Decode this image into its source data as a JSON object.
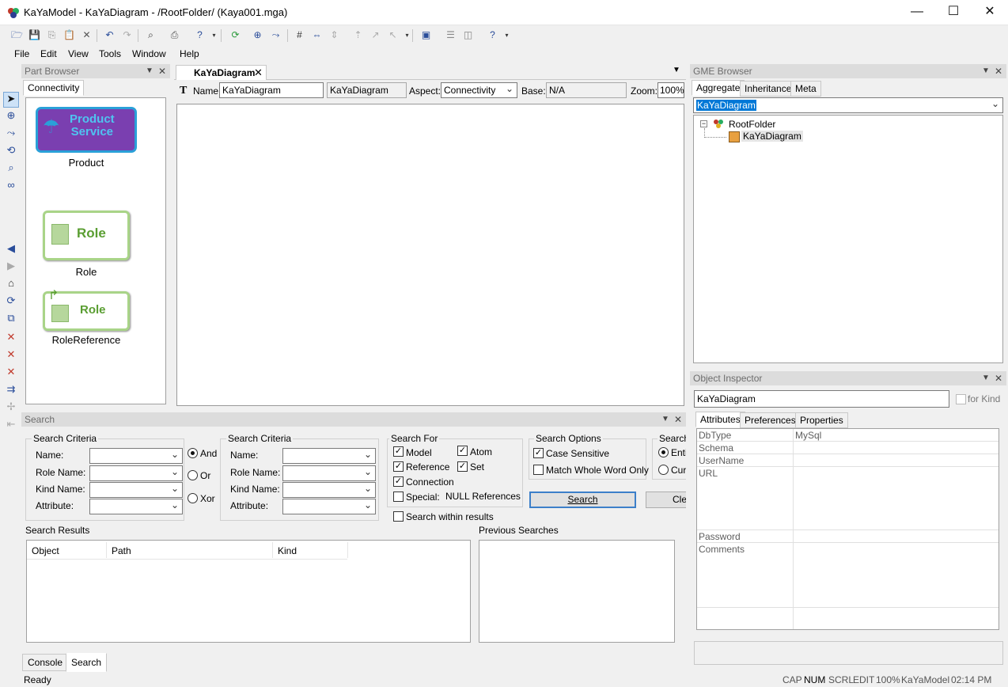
{
  "window": {
    "title": "KaYaModel - KaYaDiagram - /RootFolder/ (Kaya001.mga)",
    "minimize": "—",
    "maximize": "☐",
    "close": "✕"
  },
  "menu": [
    "File",
    "Edit",
    "View",
    "Tools",
    "Window",
    "Help"
  ],
  "part_browser": {
    "title": "Part Browser",
    "tab": "Connectivity",
    "parts": [
      {
        "label": "Product",
        "icon_text_1": "Product",
        "icon_text_2": "Service"
      },
      {
        "label": "Role",
        "icon_text": "Role"
      },
      {
        "label": "RoleReference",
        "icon_text": "Role"
      }
    ]
  },
  "editor": {
    "tab": "KaYaDiagram",
    "name_label": "Name:",
    "name_value": "KaYaDiagram",
    "kind_value": "KaYaDiagram",
    "aspect_label": "Aspect:",
    "aspect_value": "Connectivity",
    "base_label": "Base:",
    "base_value": "N/A",
    "zoom_label": "Zoom:",
    "zoom_value": "100%"
  },
  "gme_browser": {
    "title": "GME Browser",
    "tabs": [
      "Aggregate",
      "Inheritance",
      "Meta"
    ],
    "selected": "KaYaDiagram",
    "tree": {
      "root": "RootFolder",
      "child": "KaYaDiagram"
    }
  },
  "object_inspector": {
    "title": "Object Inspector",
    "name": "KaYaDiagram",
    "for_kind": "for Kind",
    "tabs": [
      "Attributes",
      "Preferences",
      "Properties"
    ],
    "rows": [
      {
        "key": "DbType",
        "value": "MySql"
      },
      {
        "key": "Schema",
        "value": ""
      },
      {
        "key": "UserName",
        "value": ""
      },
      {
        "key": "URL",
        "value": ""
      },
      {
        "key": "Password",
        "value": ""
      },
      {
        "key": "Comments",
        "value": ""
      }
    ]
  },
  "search": {
    "title": "Search",
    "criteria_title": "Search Criteria",
    "criteria_labels": [
      "Name:",
      "Role Name:",
      "Kind Name:",
      "Attribute:"
    ],
    "logic": [
      "And",
      "Or",
      "Xor"
    ],
    "search_for_title": "Search For",
    "search_for": {
      "model": "Model",
      "atom": "Atom",
      "reference": "Reference",
      "set": "Set",
      "connection": "Connection",
      "special": "Special:",
      "null_refs": "NULL References"
    },
    "options_title": "Search Options",
    "case_sensitive": "Case Sensitive",
    "match_whole": "Match Whole Word Only",
    "scope_title": "Search",
    "scope": [
      "Entire",
      "Current"
    ],
    "search_button": "Search",
    "clear_button": "Clear",
    "within_results": "Search within results",
    "results_label": "Search Results",
    "results_cols": [
      "Object",
      "Path",
      "Kind"
    ],
    "previous_label": "Previous Searches"
  },
  "bottom_tabs": [
    "Console",
    "Search"
  ],
  "status": {
    "text": "Ready",
    "indicators": [
      "CAP",
      "NUM",
      "SCRL",
      "EDIT",
      "100%",
      "KaYaModel",
      "02:14  PM"
    ]
  },
  "colors": {
    "product_fill": "#7a3fb0",
    "product_border": "#2aa0d8",
    "role_green": "#5a9e32"
  }
}
